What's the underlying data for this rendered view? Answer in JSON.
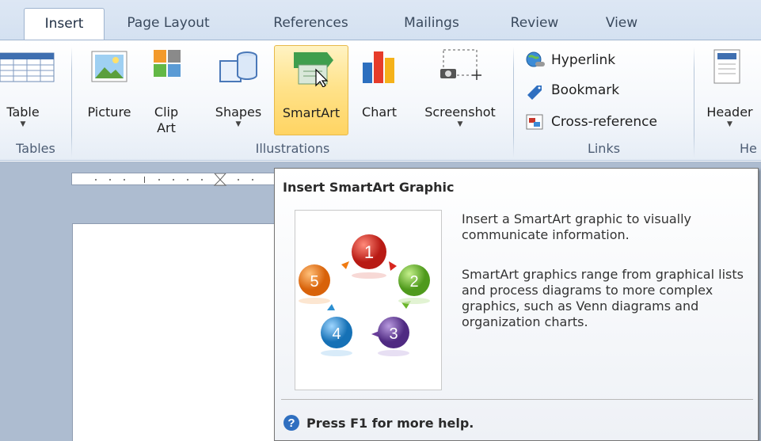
{
  "tabs": [
    {
      "label": "Insert",
      "active": true
    },
    {
      "label": "Page Layout",
      "active": false
    },
    {
      "label": "References",
      "active": false
    },
    {
      "label": "Mailings",
      "active": false
    },
    {
      "label": "Review",
      "active": false
    },
    {
      "label": "View",
      "active": false
    }
  ],
  "ribbon": {
    "groups": {
      "tables": "Tables",
      "illustrations": "Illustrations",
      "links": "Links",
      "header_footer": "He"
    },
    "buttons": {
      "table": "Table",
      "picture": "Picture",
      "clip_art_1": "Clip",
      "clip_art_2": "Art",
      "shapes": "Shapes",
      "smartart": "SmartArt",
      "chart": "Chart",
      "screenshot": "Screenshot",
      "header": "Header"
    },
    "links": {
      "hyperlink": "Hyperlink",
      "bookmark": "Bookmark",
      "cross_reference": "Cross-reference"
    }
  },
  "tooltip": {
    "title": "Insert SmartArt Graphic",
    "description_1": "Insert a SmartArt graphic to visually communicate information.",
    "description_2": "SmartArt graphics range from graphical lists and process diagrams to more complex graphics, such as Venn diagrams and organization charts.",
    "help": "Press F1 for more help.",
    "cycle_numbers": [
      "1",
      "2",
      "3",
      "4",
      "5"
    ]
  },
  "colors": {
    "accent_highlight": "#ffd463",
    "tab_strip": "#dde7f4",
    "doc_background": "#adbcd0",
    "cycle_1": "#d7261f",
    "cycle_2": "#6ab52a",
    "cycle_3": "#6a3d9a",
    "cycle_4": "#2c8fd1",
    "cycle_5": "#f07a12"
  }
}
